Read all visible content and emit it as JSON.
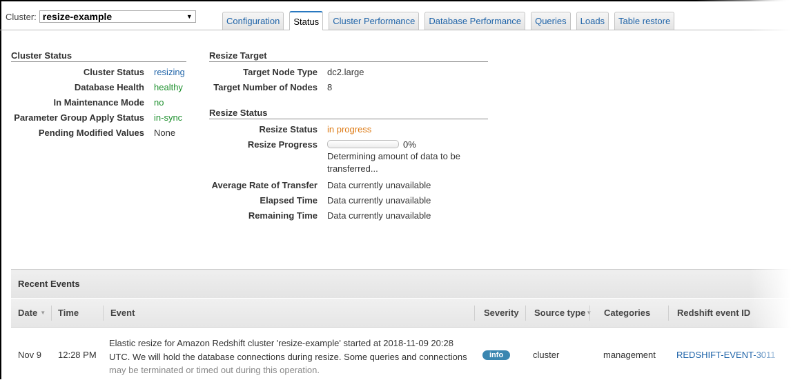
{
  "cluster_selector": {
    "label": "Cluster:",
    "value": "resize-example"
  },
  "tabs": [
    {
      "label": "Configuration",
      "active": false
    },
    {
      "label": "Status",
      "active": true
    },
    {
      "label": "Cluster Performance",
      "active": false
    },
    {
      "label": "Database Performance",
      "active": false
    },
    {
      "label": "Queries",
      "active": false
    },
    {
      "label": "Loads",
      "active": false
    },
    {
      "label": "Table restore",
      "active": false
    }
  ],
  "cluster_status": {
    "title": "Cluster Status",
    "rows": [
      {
        "key": "Cluster Status",
        "value": "resizing",
        "color": "#1e63a8"
      },
      {
        "key": "Database Health",
        "value": "healthy",
        "color": "#1c8f2c"
      },
      {
        "key": "In Maintenance Mode",
        "value": "no",
        "color": "#1c8f2c"
      },
      {
        "key": "Parameter Group Apply Status",
        "value": "in-sync",
        "color": "#1c8f2c"
      },
      {
        "key": "Pending Modified Values",
        "value": "None",
        "color": "#333333"
      }
    ]
  },
  "resize_target": {
    "title": "Resize Target",
    "rows": [
      {
        "key": "Target Node Type",
        "value": "dc2.large"
      },
      {
        "key": "Target Number of Nodes",
        "value": "8"
      }
    ]
  },
  "resize_status": {
    "title": "Resize Status",
    "status_key": "Resize Status",
    "status_value": "in progress",
    "status_color": "#dd7a14",
    "progress_key": "Resize Progress",
    "progress_percent": 0,
    "progress_label": "0%",
    "progress_note": "Determining amount of data to be transferred...",
    "rows": [
      {
        "key": "Average Rate of Transfer",
        "value": "Data currently unavailable"
      },
      {
        "key": "Elapsed Time",
        "value": "Data currently unavailable"
      },
      {
        "key": "Remaining Time",
        "value": "Data currently unavailable"
      }
    ]
  },
  "recent_events": {
    "title": "Recent Events",
    "columns": [
      "Date",
      "Time",
      "Event",
      "Severity",
      "Source type",
      "Categories",
      "Redshift event ID"
    ],
    "rows": [
      {
        "date": "Nov 9",
        "time": "12:28 PM",
        "event_line1": "Elastic resize for Amazon Redshift cluster 'resize-example' started at 2018-11-09 20:28",
        "event_line2": "UTC. We will hold the database connections during resize. Some queries and connections",
        "event_line3": "may be terminated or timed out during this operation.",
        "severity": "info",
        "source_type": "cluster",
        "categories": "management",
        "event_id": "REDSHIFT-EVENT-3011"
      }
    ]
  }
}
